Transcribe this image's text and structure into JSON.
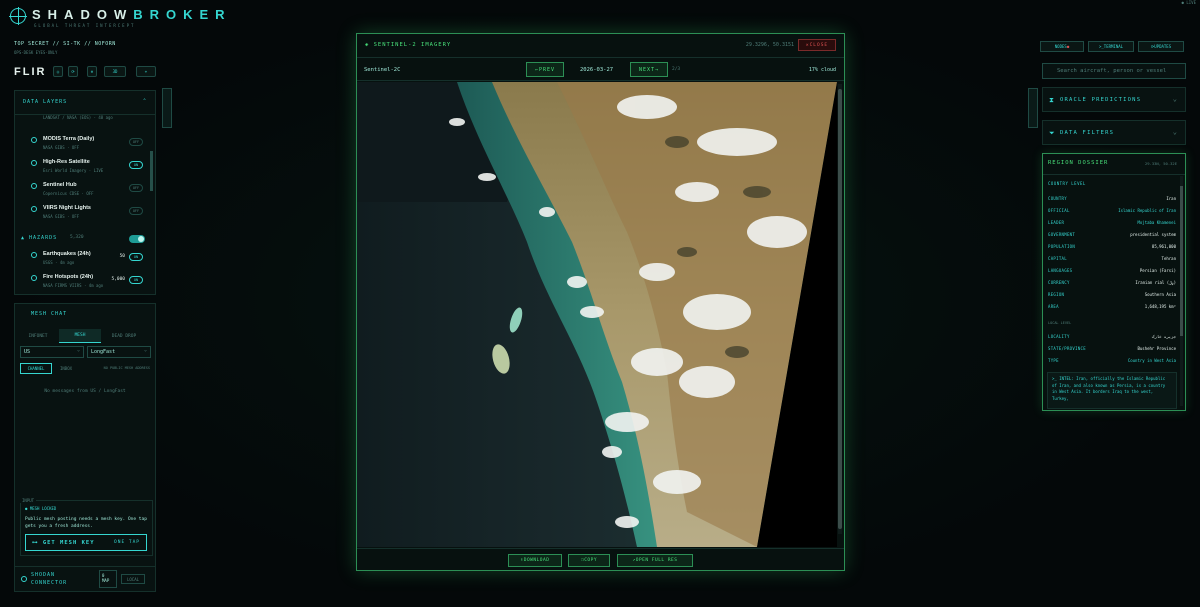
{
  "header": {
    "brand_left": "SHADOW",
    "brand_right": "BROKER",
    "subtitle": "GLOBAL THREAT INTERCEPT",
    "classification": "TOP SECRET // SI-TK // NOFORN",
    "class_sub": "OPS-DESK EYES-ONLY",
    "top_right_tiny": "● LIVE"
  },
  "flir": {
    "label": "FLIR",
    "tool_3d": "3D",
    "tool_more": "+"
  },
  "data_layers": {
    "title": "DATA LAYERS",
    "items": [
      {
        "name": "",
        "sub": "LANDSAT / NASA (EOS) · 48 ago",
        "toggle": ""
      },
      {
        "name": "MODIS Terra (Daily)",
        "sub": "NASA GIBS · OFF",
        "toggle": "OFF"
      },
      {
        "name": "High-Res Satellite",
        "sub": "Esri World Imagery · LIVE",
        "toggle": "ON"
      },
      {
        "name": "Sentinel Hub",
        "sub": "Copernicus CDSE · OFF",
        "toggle": "OFF"
      },
      {
        "name": "VIIRS Night Lights",
        "sub": "NASA GIBS · OFF",
        "toggle": "OFF"
      }
    ],
    "hazards_label": "HAZARDS",
    "hazards_count": "5,320",
    "hazard_items": [
      {
        "name": "Earthquakes (24h)",
        "sub": "USGS · 4m ago",
        "count": "50",
        "toggle": "ON"
      },
      {
        "name": "Fire Hotspots (24h)",
        "sub": "NASA FIRMS VIIRS · 4m ago",
        "count": "5,000",
        "toggle": "ON"
      }
    ]
  },
  "mesh": {
    "title": "MESH CHAT",
    "tabs": [
      "INFONET",
      "MESH",
      "DEAD DROP"
    ],
    "region": "US",
    "preset": "LongFast",
    "btn_channel": "CHANNEL",
    "btn_inbox": "INBOX",
    "no_addr": "NO PUBLIC MESH ADDRESS",
    "empty": "No messages from US / LongFast",
    "input_label": "INPUT",
    "locked": "● MESH LOCKED",
    "locked_msg": "Public mesh posting needs a mesh key. One tap gets you a fresh address.",
    "get_key": "GET MESH KEY",
    "one_tap": "ONE TAP"
  },
  "shodan": {
    "line1": "SHODAN",
    "line2": "CONNECTOR",
    "map_line1": "0",
    "map_line2": "MAP",
    "local": "LOCAL"
  },
  "modal": {
    "title": "SENTINEL-2 IMAGERY",
    "coords": "29.3296, 50.3151",
    "close": "CLOSE",
    "source": "Sentinel-2C",
    "prev": "PREV",
    "date": "2026-03-27",
    "next": "NEXT",
    "page": "2/3",
    "cloud": "17% cloud",
    "download": "DOWNLOAD",
    "copy": "COPY",
    "open_full": "OPEN FULL RES"
  },
  "right": {
    "btn_nodes": "NODES",
    "btn_terminal": "TERMINAL",
    "btn_updates": "UPDATES",
    "search_placeholder": "Search aircraft, person or vessel",
    "oracle": "ORACLE PREDICTIONS",
    "filters": "DATA FILTERS"
  },
  "dossier": {
    "title": "REGION DOSSIER",
    "coords": "29.33N, 50.32E",
    "level": "COUNTRY LEVEL",
    "rows": [
      {
        "k": "COUNTRY",
        "v": "Iran"
      },
      {
        "k": "OFFICIAL",
        "v": "Islamic Republic of Iran"
      },
      {
        "k": "LEADER",
        "v": "Mojtaba Khamenei"
      },
      {
        "k": "GOVERNMENT",
        "v": "presidential system"
      },
      {
        "k": "POPULATION",
        "v": "85,961,000"
      },
      {
        "k": "CAPITAL",
        "v": "Tehran"
      },
      {
        "k": "LANGUAGES",
        "v": "Persian (Farsi)"
      },
      {
        "k": "CURRENCY",
        "v": "Iranian rial (﷼)"
      },
      {
        "k": "REGION",
        "v": "Southern Asia"
      },
      {
        "k": "AREA",
        "v": "1,648,195 km²"
      }
    ],
    "local_label": "LOCAL LEVEL",
    "local_rows": [
      {
        "k": "LOCALITY",
        "v": "جزیره خارک"
      },
      {
        "k": "STATE/PROVINCE",
        "v": "Bushehr Province"
      },
      {
        "k": "TYPE",
        "v": "Country in West Asia"
      }
    ],
    "intel": ">_ INTEL: Iran, officially the Islamic Republic of Iran, and also known as Persia, is a country in West Asia. It borders Iraq to the west, Turkey,"
  },
  "colors": {
    "accent": "#35d6d0",
    "modal": "#48e07a",
    "danger": "#e05252"
  }
}
